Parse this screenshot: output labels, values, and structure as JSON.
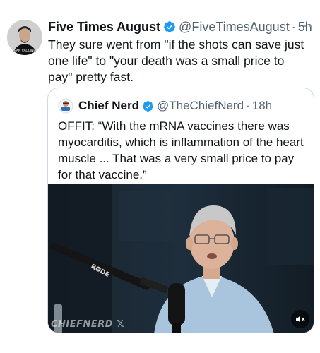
{
  "tweet": {
    "author": {
      "name": "Five Times August",
      "handle": "@FiveTimesAugust",
      "time": "5h",
      "avatar_text": "BAN VACCINE"
    },
    "separator": "·",
    "more_label": "···",
    "text": "They sure went from \"if the shots can save just one life\" to \"your death was a small price to pay\" pretty fast.",
    "verified_icon": "verified-badge-icon"
  },
  "quote": {
    "author": {
      "name": "Chief Nerd",
      "handle": "@TheChiefNerd",
      "time": "18h"
    },
    "separator": "·",
    "text": "OFFIT: “With the mRNA vaccines there was myocarditis, which is inflammation of the heart muscle ... That was a very small price to pay for that vaccine.”",
    "video": {
      "mic_brand": "RØDE",
      "watermark": "CHIEFNERD",
      "watermark_suffix": "𝕏",
      "mute_icon": "volume-muted-icon"
    }
  },
  "colors": {
    "text": "#0f1419",
    "secondary": "#536471",
    "verified": "#1d9bf0",
    "border": "#cfd9de"
  }
}
